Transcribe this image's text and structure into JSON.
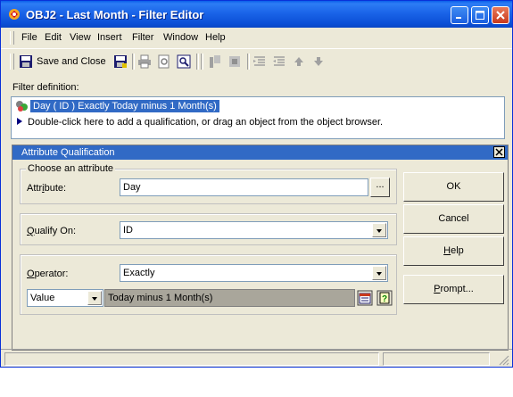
{
  "window": {
    "title": "OBJ2 - Last Month - Filter Editor",
    "colors": {
      "titlebar": "#0a5fea",
      "selection": "#316ac5",
      "face": "#ece9d8"
    }
  },
  "menu": [
    {
      "label": "File"
    },
    {
      "label": "Edit"
    },
    {
      "label": "View"
    },
    {
      "label": "Insert"
    },
    {
      "label": "Filter"
    },
    {
      "label": "Window"
    },
    {
      "label": "Help"
    }
  ],
  "toolbar": {
    "save_close_label": "Save and Close",
    "icons": [
      "save-close-icon",
      "save-icon",
      "print-icon",
      "print-preview-icon",
      "find-icon",
      "attribute-icon",
      "metric-icon",
      "indent-icon",
      "outdent-icon",
      "move-up-icon",
      "move-down-icon"
    ]
  },
  "filter": {
    "label": "Filter definition:",
    "qualification": "Day ( ID ) Exactly Today minus  1 Month(s)",
    "hint": "Double-click here to add a qualification, or drag an object from the object browser."
  },
  "panel": {
    "title": "Attribute Qualification",
    "choose_group": "Choose an attribute",
    "attribute_label": "Attribute:",
    "attribute_value": "Day",
    "browse_label": "...",
    "qualify_label": "Qualify On:",
    "qualify_value": "ID",
    "operator_label": "Operator:",
    "operator_value": "Exactly",
    "value_type": "Value",
    "value_text": "Today minus  1 Month(s)"
  },
  "buttons": {
    "ok": "OK",
    "cancel": "Cancel",
    "help": "Help",
    "prompt": "Prompt..."
  }
}
